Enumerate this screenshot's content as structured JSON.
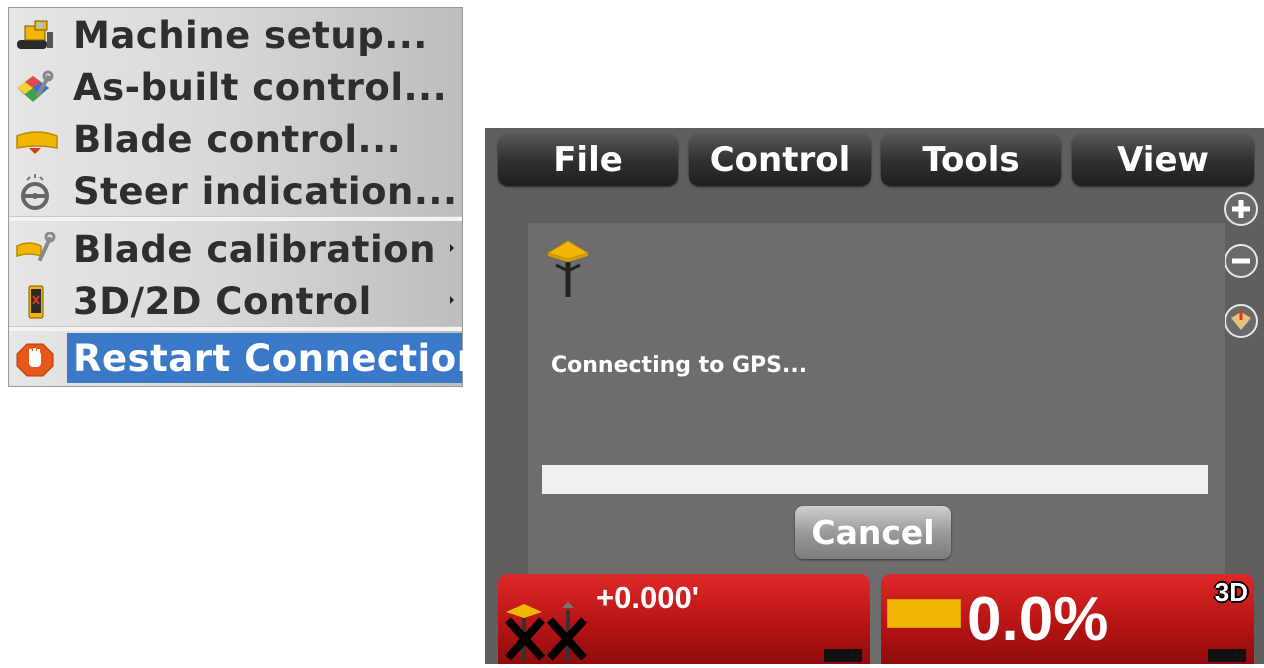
{
  "menu": {
    "items": [
      {
        "label": "Machine setup...",
        "icon": "bulldozer-icon",
        "submenu": false
      },
      {
        "label": "As-built control...",
        "icon": "asbuilt-map-wrench-icon",
        "submenu": false
      },
      {
        "label": "Blade control...",
        "icon": "blade-icon",
        "submenu": false
      },
      {
        "label": "Steer indication...",
        "icon": "steering-wheel-icon",
        "submenu": false
      },
      {
        "label": "Blade calibration",
        "icon": "blade-wrench-icon",
        "submenu": true
      },
      {
        "label": "3D/2D Control",
        "icon": "control-box-icon",
        "submenu": true
      },
      {
        "label": "Restart Connection",
        "icon": "stop-hand-icon",
        "submenu": false,
        "selected": true
      }
    ]
  },
  "device": {
    "tabs": [
      {
        "label": "File"
      },
      {
        "label": "Control"
      },
      {
        "label": "Tools"
      },
      {
        "label": "View"
      }
    ],
    "side_buttons": [
      "zoom-in-icon",
      "zoom-out-icon",
      "map-icon"
    ],
    "dialog": {
      "icon": "gps-antenna-icon",
      "message": "Connecting to GPS...",
      "progress_percent": 0,
      "cancel_label": "Cancel"
    },
    "status": {
      "elevation": "+0.000'",
      "slope": "0.0%",
      "mode": "3D"
    }
  },
  "colors": {
    "menu_highlight": "#3a78c8",
    "device_bg": "#5f5f5f",
    "dialog_bg": "#6d6d6d",
    "status_red": "#c81e1e",
    "blade_yellow": "#f2b705"
  }
}
